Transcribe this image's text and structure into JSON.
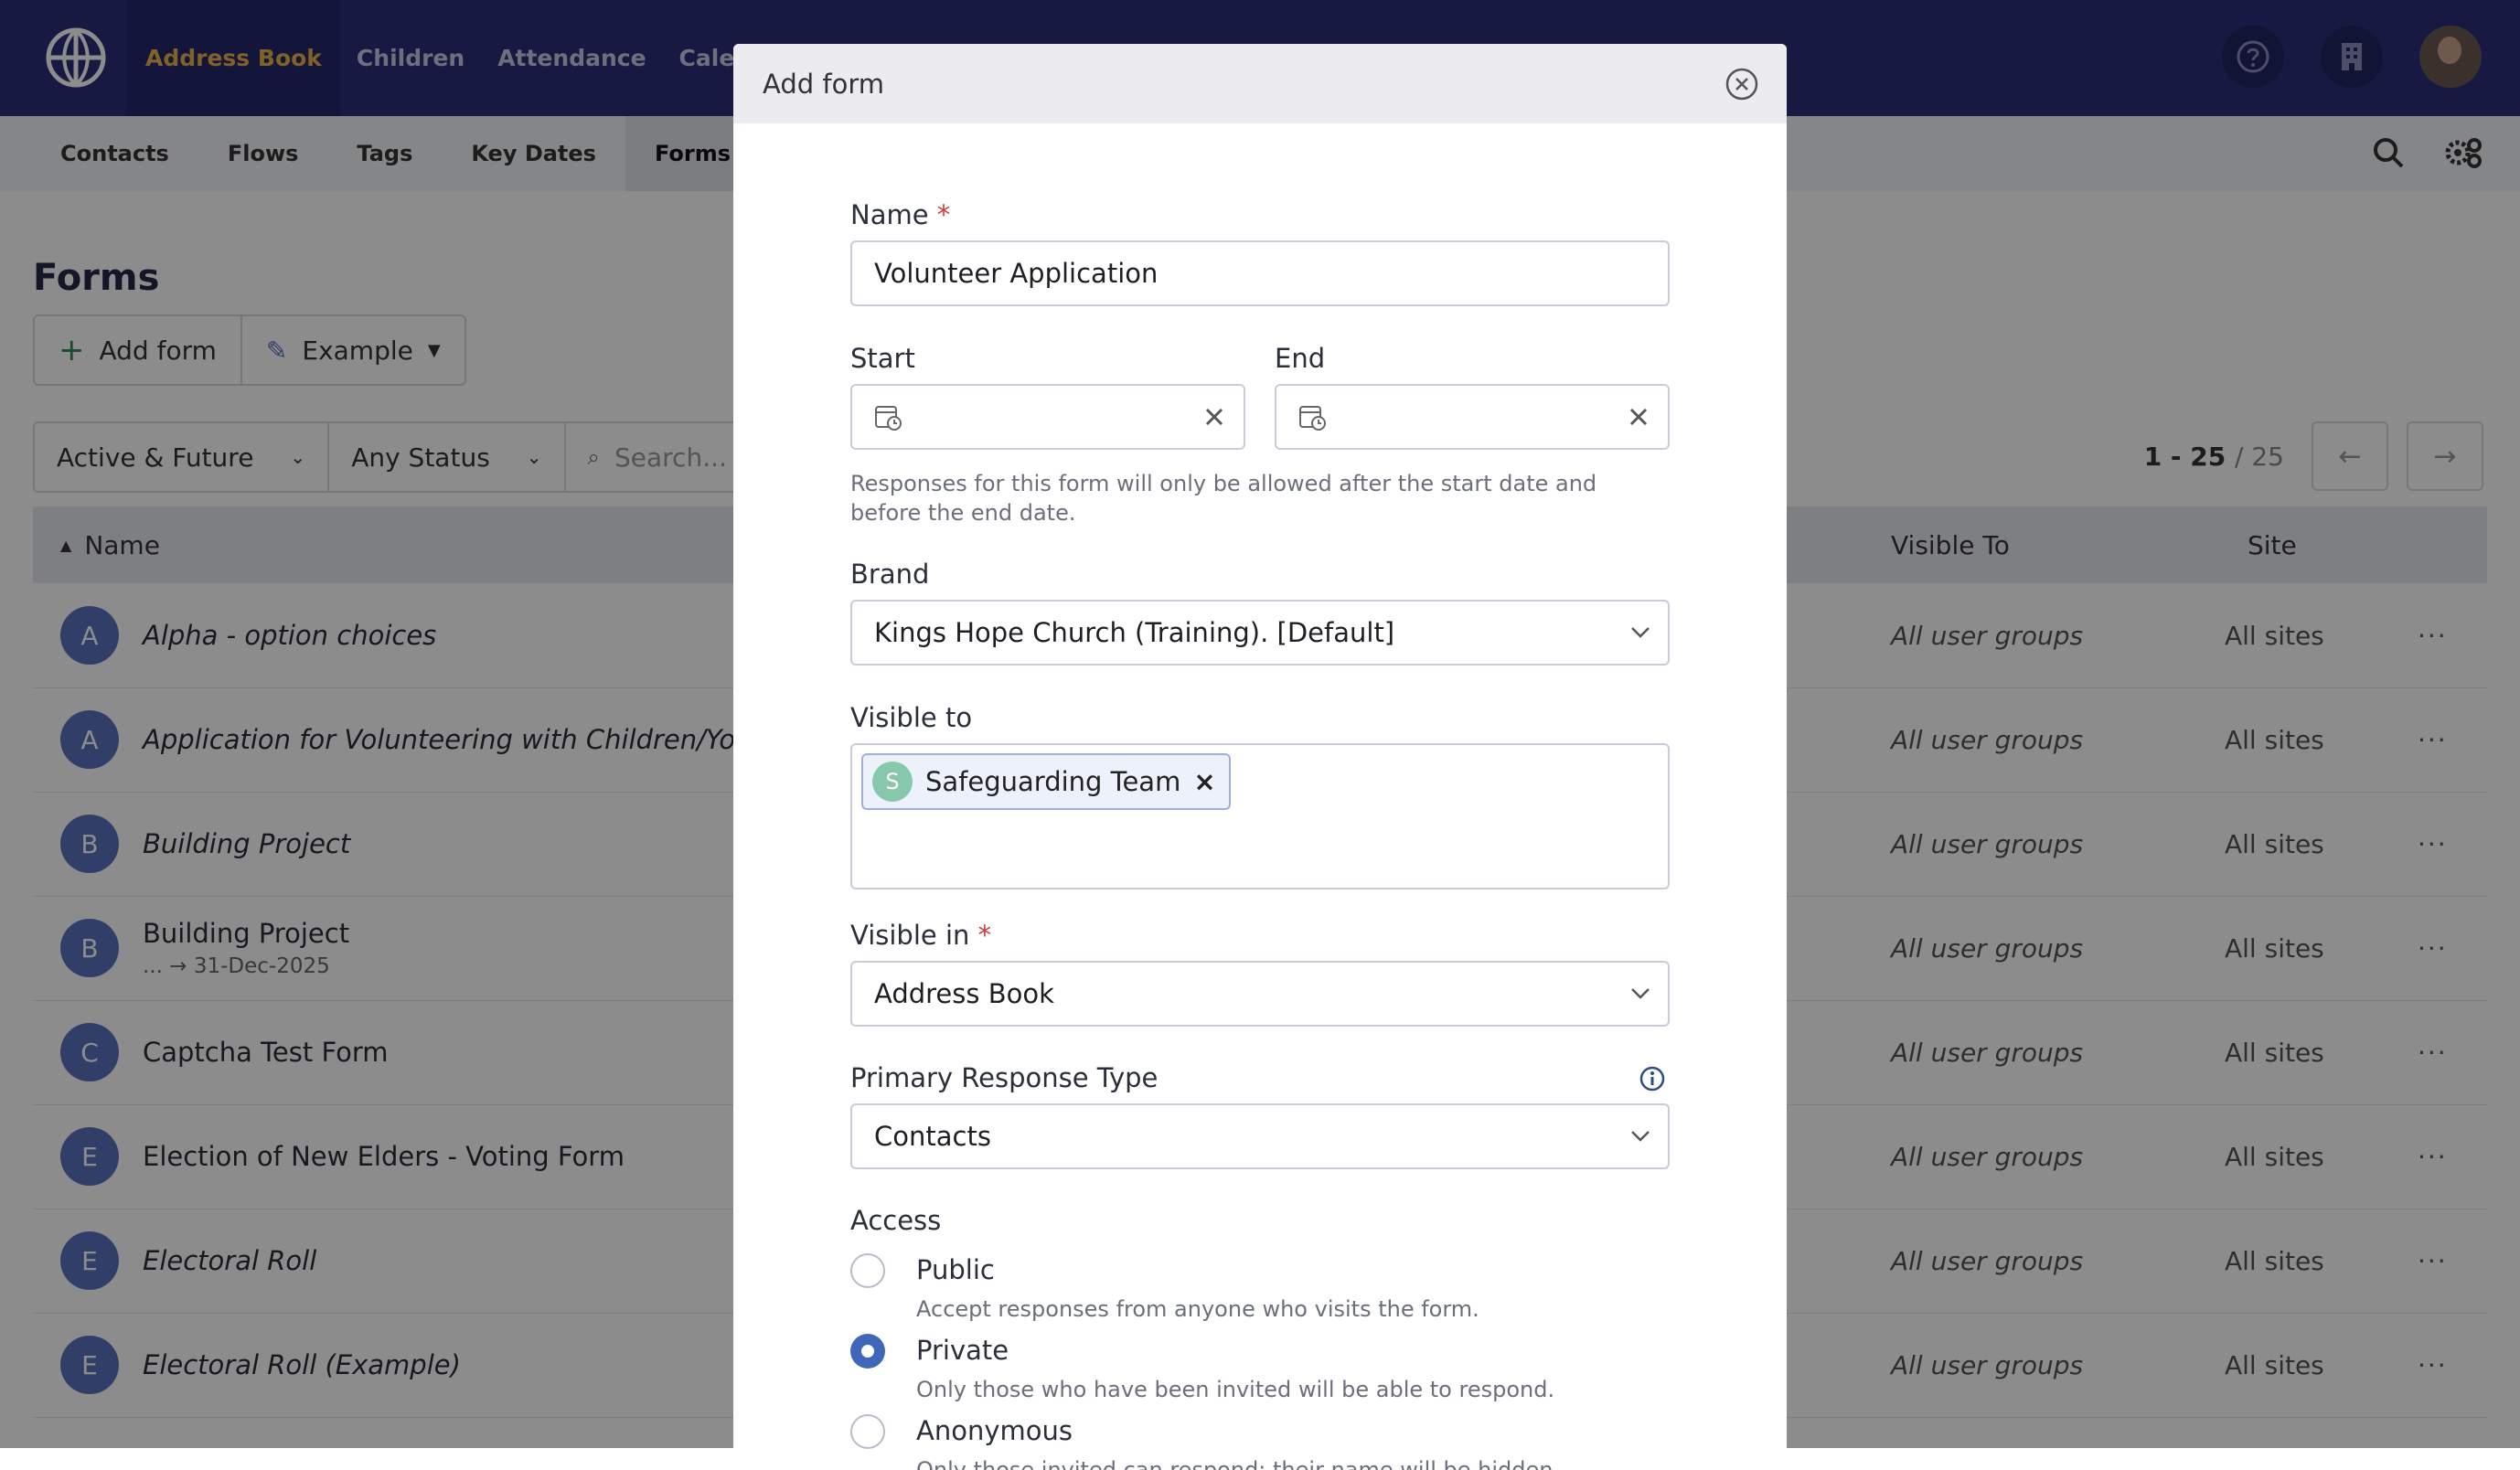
{
  "topnav": {
    "items": [
      "Address Book",
      "Children",
      "Attendance",
      "Calendar"
    ]
  },
  "subnav": {
    "items": [
      "Contacts",
      "Flows",
      "Tags",
      "Key Dates",
      "Forms"
    ]
  },
  "page": {
    "title": "Forms",
    "add_form_label": "Add form",
    "example_label": "Example",
    "filter_date": "Active & Future",
    "filter_status": "Any Status",
    "search_placeholder": "Search...",
    "pager_range": "1 - 25",
    "pager_total": "/ 25"
  },
  "table": {
    "headers": {
      "name": "Name",
      "visible_to": "Visible To",
      "site": "Site"
    },
    "rows": [
      {
        "initial": "A",
        "name": "Alpha - option choices",
        "sub": "",
        "visible_to": "All user groups",
        "site": "All sites"
      },
      {
        "initial": "A",
        "name": "Application for Volunteering with Children/Youth",
        "sub": "",
        "visible_to": "All user groups",
        "site": "All sites"
      },
      {
        "initial": "B",
        "name": "Building Project",
        "sub": "",
        "visible_to": "All user groups",
        "site": "All sites"
      },
      {
        "initial": "B",
        "name": "Building Project",
        "sub": "... → 31-Dec-2025",
        "visible_to": "All user groups",
        "site": "All sites"
      },
      {
        "initial": "C",
        "name": "Captcha Test Form",
        "sub": "",
        "visible_to": "All user groups",
        "site": "All sites"
      },
      {
        "initial": "E",
        "name": "Election of New Elders - Voting Form",
        "sub": "",
        "visible_to": "All user groups",
        "site": "All sites"
      },
      {
        "initial": "E",
        "name": "Electoral Roll",
        "sub": "",
        "visible_to": "All user groups",
        "site": "All sites"
      },
      {
        "initial": "E",
        "name": "Electoral Roll (Example)",
        "sub": "",
        "visible_to": "All user groups",
        "site": "All sites"
      }
    ],
    "row_actions": "···"
  },
  "modal": {
    "title": "Add form",
    "name_label": "Name",
    "required_mark": "*",
    "name_value": "Volunteer Application",
    "start_label": "Start",
    "end_label": "End",
    "date_help": "Responses for this form will only be allowed after the start date and before the end date.",
    "brand_label": "Brand",
    "brand_value": "Kings Hope Church (Training). [Default]",
    "visible_to_label": "Visible to",
    "visible_to_tag_initial": "S",
    "visible_to_tag": "Safeguarding Team",
    "tag_remove": "×",
    "visible_in_label": "Visible in",
    "visible_in_value": "Address Book",
    "primary_response_label": "Primary Response Type",
    "primary_response_value": "Contacts",
    "access_label": "Access",
    "access_options": [
      {
        "title": "Public",
        "desc": "Accept responses from anyone who visits the form.",
        "selected": false
      },
      {
        "title": "Private",
        "desc": "Only those who have been invited will be able to respond.",
        "selected": true
      },
      {
        "title": "Anonymous",
        "desc": "Only those invited can respond; their name will be hidden.",
        "selected": false
      }
    ]
  },
  "colors": {
    "topbar": "#2a2f78",
    "accent_active_nav": "#e8b24a",
    "required": "#d03b3b",
    "radio_selected": "#3f66b8",
    "tag_avatar": "#87c8ab"
  },
  "icons": {
    "logo": "globe-logo-icon",
    "help": "question-circle-icon",
    "building": "building-icon",
    "search": "search-icon",
    "settings": "gear-icon",
    "close": "close-circle-icon",
    "calendar": "calendar-clock-icon",
    "clear": "x-icon",
    "chevron": "chevron-down-icon",
    "info": "info-circle-icon"
  }
}
